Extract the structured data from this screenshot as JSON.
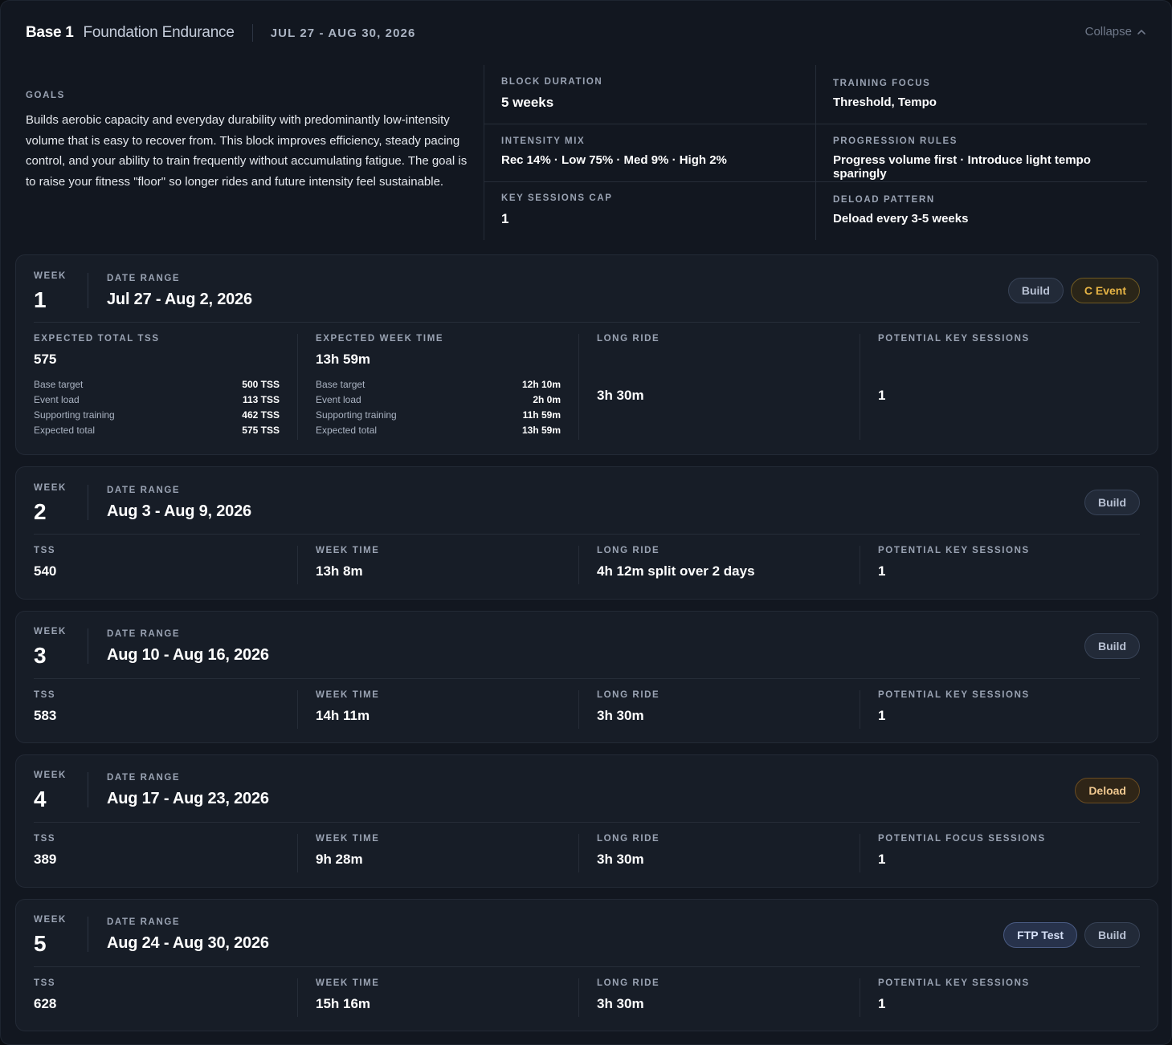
{
  "header": {
    "block_name": "Base 1",
    "block_subtitle": "Foundation Endurance",
    "date_range": "JUL 27 - AUG 30, 2026",
    "collapse_label": "Collapse"
  },
  "overview": {
    "goals_label": "GOALS",
    "goals_text": "Builds aerobic capacity and everyday durability with predominantly low-intensity volume that is easy to recover from. This block improves efficiency, steady pacing control, and your ability to train frequently without accumulating fatigue. The goal is to raise your fitness \"floor\" so longer rides and future intensity feel sustainable.",
    "block_duration": {
      "label": "BLOCK DURATION",
      "value": "5 weeks"
    },
    "intensity_mix": {
      "label": "INTENSITY MIX",
      "value": "Rec 14% · Low 75% · Med 9% · High 2%"
    },
    "key_sessions_cap": {
      "label": "KEY SESSIONS CAP",
      "value": "1"
    },
    "training_focus": {
      "label": "TRAINING FOCUS",
      "value": "Threshold, Tempo"
    },
    "progression_rules": {
      "label": "PROGRESSION RULES",
      "value": "Progress volume first · Introduce light tempo sparingly"
    },
    "deload_pattern": {
      "label": "DELOAD PATTERN",
      "value": "Deload every 3-5 weeks"
    }
  },
  "labels": {
    "week": "WEEK",
    "date_range": "DATE RANGE",
    "tss": "TSS",
    "week_time": "WEEK TIME",
    "long_ride": "LONG RIDE",
    "potential_key_sessions": "POTENTIAL KEY SESSIONS",
    "expected_total_tss": "EXPECTED TOTAL TSS",
    "expected_week_time": "EXPECTED WEEK TIME"
  },
  "weeks": [
    {
      "number": "1",
      "date_range": "Jul 27 - Aug 2, 2026",
      "badges": [
        {
          "label": "Build",
          "kind": "build"
        },
        {
          "label": "C Event",
          "kind": "event"
        }
      ],
      "tss": "575",
      "week_time": "13h 59m",
      "long_ride": "3h 30m",
      "sessions_label": "POTENTIAL KEY SESSIONS",
      "sessions": "1",
      "tss_breakdown": [
        {
          "k": "Base target",
          "v": "500 TSS"
        },
        {
          "k": "Event load",
          "v": "113 TSS"
        },
        {
          "k": "Supporting training",
          "v": "462 TSS"
        },
        {
          "k": "Expected total",
          "v": "575 TSS"
        }
      ],
      "time_breakdown": [
        {
          "k": "Base target",
          "v": "12h 10m"
        },
        {
          "k": "Event load",
          "v": "2h 0m"
        },
        {
          "k": "Supporting training",
          "v": "11h 59m"
        },
        {
          "k": "Expected total",
          "v": "13h 59m"
        }
      ]
    },
    {
      "number": "2",
      "date_range": "Aug 3 - Aug 9, 2026",
      "badges": [
        {
          "label": "Build",
          "kind": "build"
        }
      ],
      "tss": "540",
      "week_time": "13h 8m",
      "long_ride": "4h 12m split over 2 days",
      "sessions_label": "POTENTIAL KEY SESSIONS",
      "sessions": "1"
    },
    {
      "number": "3",
      "date_range": "Aug 10 - Aug 16, 2026",
      "badges": [
        {
          "label": "Build",
          "kind": "build"
        }
      ],
      "tss": "583",
      "week_time": "14h 11m",
      "long_ride": "3h 30m",
      "sessions_label": "POTENTIAL KEY SESSIONS",
      "sessions": "1"
    },
    {
      "number": "4",
      "date_range": "Aug 17 - Aug 23, 2026",
      "badges": [
        {
          "label": "Deload",
          "kind": "deload"
        }
      ],
      "tss": "389",
      "week_time": "9h 28m",
      "long_ride": "3h 30m",
      "sessions_label": "POTENTIAL FOCUS SESSIONS",
      "sessions": "1"
    },
    {
      "number": "5",
      "date_range": "Aug 24 - Aug 30, 2026",
      "badges": [
        {
          "label": "FTP Test",
          "kind": "ftp"
        },
        {
          "label": "Build",
          "kind": "build"
        }
      ],
      "tss": "628",
      "week_time": "15h 16m",
      "long_ride": "3h 30m",
      "sessions_label": "POTENTIAL KEY SESSIONS",
      "sessions": "1"
    }
  ]
}
